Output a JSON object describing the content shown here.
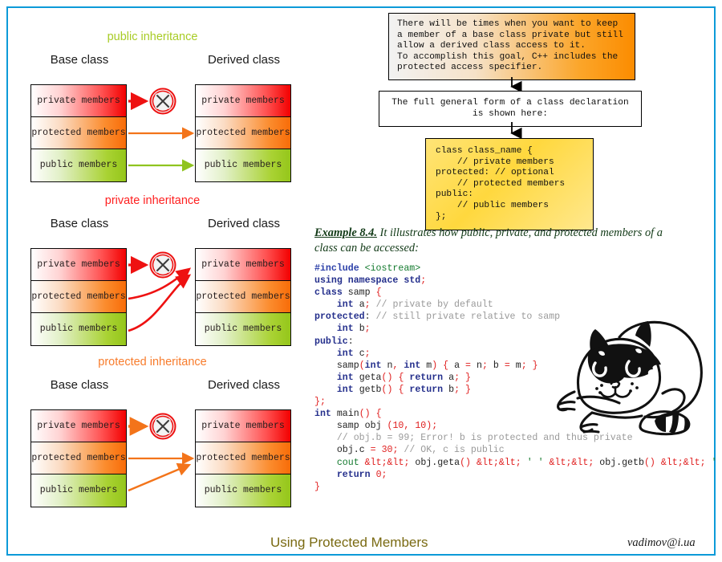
{
  "frame": {
    "border_color": "#0c9ad8"
  },
  "diagrams": [
    {
      "id": "public-inheritance",
      "label": "public inheritance",
      "label_color": "#a8cc26",
      "base_title": "Base class",
      "derived_title": "Derived class",
      "base_rows": [
        "private members",
        "protected members",
        "public members"
      ],
      "derived_rows": [
        "private members",
        "protected members",
        "public members"
      ],
      "blocked_icon": "blocked-x-icon",
      "arrows": [
        {
          "from": "private",
          "to": "blocked",
          "color": "#ee1111"
        },
        {
          "from": "protected",
          "to": "protected",
          "color": "#f3741a"
        },
        {
          "from": "public",
          "to": "public",
          "color": "#8fc41f"
        }
      ]
    },
    {
      "id": "private-inheritance",
      "label": "private inheritance",
      "label_color": "#ff2020",
      "base_title": "Base class",
      "derived_title": "Derived class",
      "base_rows": [
        "private members",
        "protected members",
        "public members"
      ],
      "derived_rows": [
        "private members",
        "protected members",
        "public members"
      ],
      "blocked_icon": "blocked-x-icon",
      "arrows": [
        {
          "from": "private",
          "to": "blocked",
          "color": "#ee1111"
        },
        {
          "from": "protected",
          "to": "private",
          "color": "#ee1111"
        },
        {
          "from": "public",
          "to": "private",
          "color": "#ee1111"
        }
      ]
    },
    {
      "id": "protected-inheritance",
      "label": "protected inheritance",
      "label_color": "#f87c2c",
      "base_title": "Base class",
      "derived_title": "Derived class",
      "base_rows": [
        "private members",
        "protected members",
        "public members"
      ],
      "derived_rows": [
        "private members",
        "protected members",
        "public members"
      ],
      "blocked_icon": "blocked-x-icon",
      "arrows": [
        {
          "from": "private",
          "to": "blocked",
          "color": "#ee1111"
        },
        {
          "from": "protected",
          "to": "protected",
          "color": "#f3741a"
        },
        {
          "from": "public",
          "to": "protected",
          "color": "#f3741a"
        }
      ]
    }
  ],
  "right": {
    "intro_box": "There will be times when you want to keep\na member of a base class private but still\nallow a derived class access to it.\nTo accomplish this goal, C++ includes the\nprotected access specifier.",
    "middle_box": "The full general form of a class declaration\nis shown here:",
    "code_box": "class class_name {\n    // private members\nprotected: // optional\n    // protected members\npublic:\n    // public members\n};",
    "example_head": "Example 8.4.",
    "example_text": " It illustrates how public, private, and protected members of a class can be accessed:"
  },
  "code_listing": {
    "lines": [
      "#include <iostream>",
      "using namespace std;",
      "class samp {",
      "    int a; // private by default",
      "protected: // still private relative to samp",
      "    int b;",
      "public:",
      "    int c;",
      "    samp(int n, int m) { a = n; b = m; }",
      "    int geta() { return a; }",
      "    int getb() { return b; }",
      "};",
      "int main() {",
      "    samp obj (10, 10);",
      "    // obj.b = 99; Error! b is protected and thus private",
      "    obj.c = 30; // OK, c is public",
      "    cout << obj.geta() << ' ' << obj.getb() << ' ' << obj.c << '\\n';",
      "    return 0;",
      "}"
    ]
  },
  "illustration": {
    "name": "cat-illustration",
    "alt": "cartoon cat lying down"
  },
  "footer": {
    "title": "Using Protected Members",
    "title_color": "#7a6a12",
    "email": "vadimov@i.ua"
  }
}
